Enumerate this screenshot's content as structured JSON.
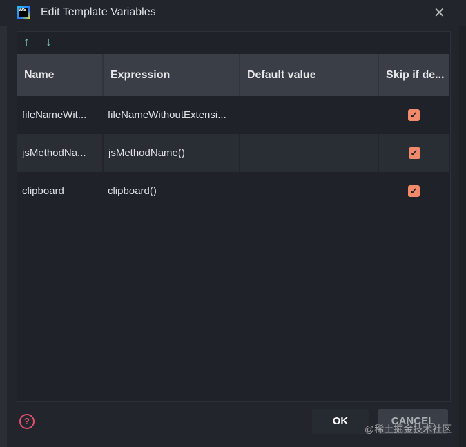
{
  "window": {
    "title": "Edit Template Variables",
    "app_icon_text": "WS"
  },
  "toolbar": {
    "up": "↑",
    "down": "↓"
  },
  "table": {
    "headers": [
      "Name",
      "Expression",
      "Default value",
      "Skip if de..."
    ],
    "rows": [
      {
        "name": "fileNameWit...",
        "expression": "fileNameWithoutExtensi...",
        "default": "",
        "skip": true
      },
      {
        "name": "jsMethodNa...",
        "expression": "jsMethodName()",
        "default": "",
        "skip": true
      },
      {
        "name": "clipboard",
        "expression": "clipboard()",
        "default": "",
        "skip": true
      }
    ]
  },
  "buttons": {
    "ok": "OK",
    "cancel": "CANCEL",
    "help": "?"
  },
  "watermark": "@稀土掘金技术社区",
  "colors": {
    "checkbox": "#f08a6a",
    "arrows": "#6fc2a8",
    "help": "#e0506e"
  }
}
